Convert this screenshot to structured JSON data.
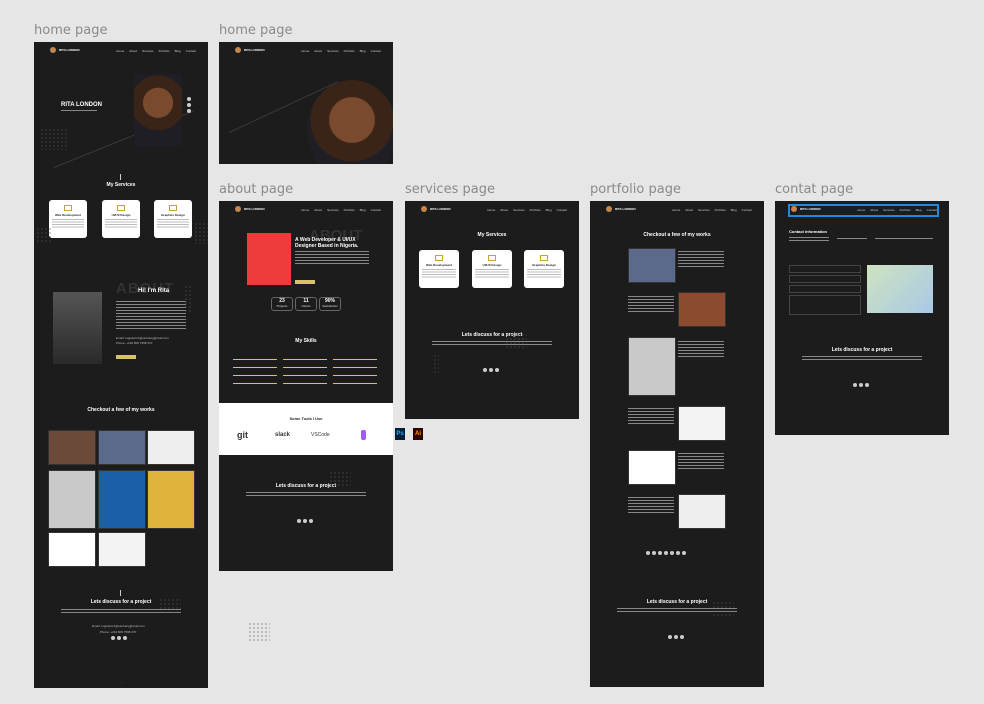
{
  "labels": {
    "home1": "home page",
    "home2": "home page",
    "about": "about page",
    "services": "services page",
    "portfolio": "portfolio page",
    "contact": "contat page"
  },
  "nav": {
    "brand": "RITA LONDON",
    "links": [
      "Home",
      "About",
      "Services",
      "Portfolio",
      "Blog",
      "Contact"
    ]
  },
  "home": {
    "hero_name": "RITA LONDON",
    "services_heading": "My Services",
    "services": [
      "Web Development",
      "UI/UX Design",
      "Graphics Design"
    ],
    "about_heading": "Hi! I'm Rita",
    "about_watermark": "ABOUT",
    "portfolio_heading": "Checkout a few of my works",
    "discuss_heading": "Lets discuss for  a project",
    "email": "Email: ruguskrts7@senhang@mail.com",
    "phone": "Phone: +234 805 7598 370"
  },
  "about": {
    "watermark": "ABOUT",
    "title": "A Web Developer & UI/UX Designer Based in Nigeria.",
    "stats": [
      {
        "value": "23",
        "label": "Projects"
      },
      {
        "value": "11",
        "label": "Clients"
      },
      {
        "value": "90%",
        "label": "Satisfaction"
      }
    ],
    "skills_heading": "My Skills",
    "tools_heading": "Some Tools I Use",
    "tools": [
      "git",
      "slack",
      "VSCode",
      "Ps",
      "Ai"
    ],
    "discuss_heading": "Lets discuss for  a project"
  },
  "services_page": {
    "heading": "My Services",
    "services": [
      "Web Development",
      "UI/UX Design",
      "Graphics Design"
    ],
    "discuss_heading": "Lets discuss for  a project"
  },
  "portfolio_page": {
    "heading": "Checkout a few of my works",
    "discuss_heading": "Lets discuss for  a project"
  },
  "contact_page": {
    "heading": "Contact information",
    "discuss_heading": "Lets discuss for  a project"
  },
  "colors": {
    "accent": "#d7c16a",
    "highlight": "#1e88e5",
    "dark": "#1c1c1c",
    "red_block": "#ef3b3b"
  }
}
